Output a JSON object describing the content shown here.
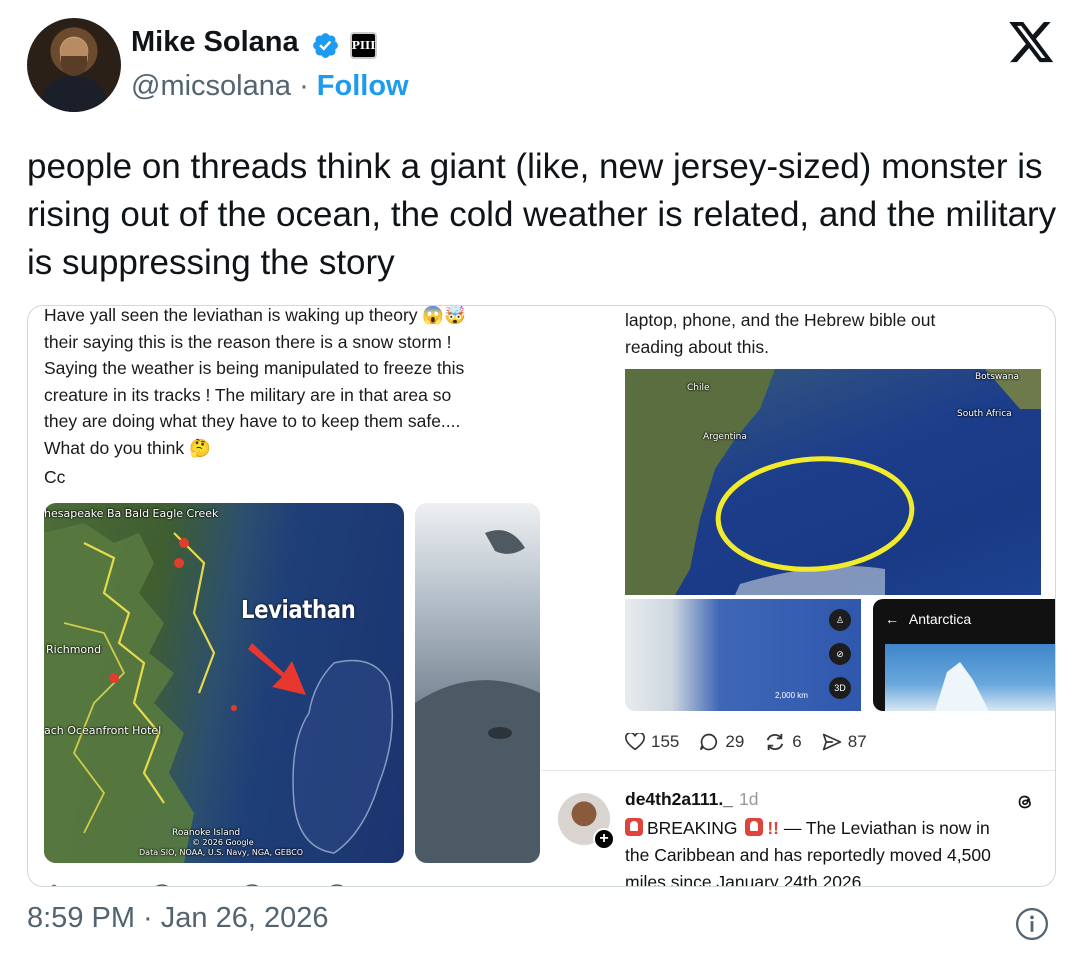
{
  "author": {
    "name": "Mike Solana",
    "handle": "@micsolana",
    "separator": "·",
    "follow_label": "Follow",
    "affiliate_badge": "PIII"
  },
  "tweet": {
    "text": "people on threads think a giant (like, new jersey-sized) monster is rising out of the ocean, the cold weather is related, and the military is suppressing the story",
    "timestamp": "8:59 PM · Jan 26, 2026"
  },
  "media": {
    "left_post": {
      "lines": [
        "Have yall seen the leviathan is waking up theory 😱🤯",
        "their saying this is the reason there is a snow storm !",
        "Saying the weather is being manipulated to freeze this",
        "creature in its tracks ! The military are in that area so",
        "they are doing what they have to to keep them safe....",
        "What do you think 🤔",
        "Cc"
      ],
      "map_labels": {
        "top": "hesapeake Ba Bald Eagle Creek",
        "richmond": "Richmond",
        "hotel": "ach Oceanfront Hotel",
        "leviathan": "Leviathan",
        "roanoke": "Roanoke Island",
        "credits": "Data SIO, NOAA, U.S. Navy, NGA, GEBCO",
        "google": "© 2026 Google"
      }
    },
    "right_post": {
      "lines": [
        "laptop, phone, and the Hebrew bible out",
        "reading about this."
      ],
      "map_labels": {
        "chile": "Chile",
        "argentina": "Argentina",
        "botswana": "Botswana",
        "south_africa": "South Africa",
        "scale": "2,000 km",
        "mode_3d": "3D"
      },
      "antarctica_title": "Antarctica",
      "engagement": {
        "likes": "155",
        "comments": "29",
        "reposts": "6",
        "shares": "87"
      }
    },
    "reply": {
      "username": "de4th2a111._",
      "time": "1d",
      "breaking_label": "BREAKING",
      "bangs": "!!",
      "line1_rest": "— The Leviathan is now in",
      "line2": "the Caribbean and has reportedly moved 4,500",
      "line3": "miles since January 24th 2026"
    }
  },
  "colors": {
    "follow_blue": "#1d9bf0",
    "muted_gray": "#536471",
    "verified_blue": "#1d9bf0",
    "highlight_yellow": "#f2ea2c",
    "arrow_red": "#e8372e"
  }
}
